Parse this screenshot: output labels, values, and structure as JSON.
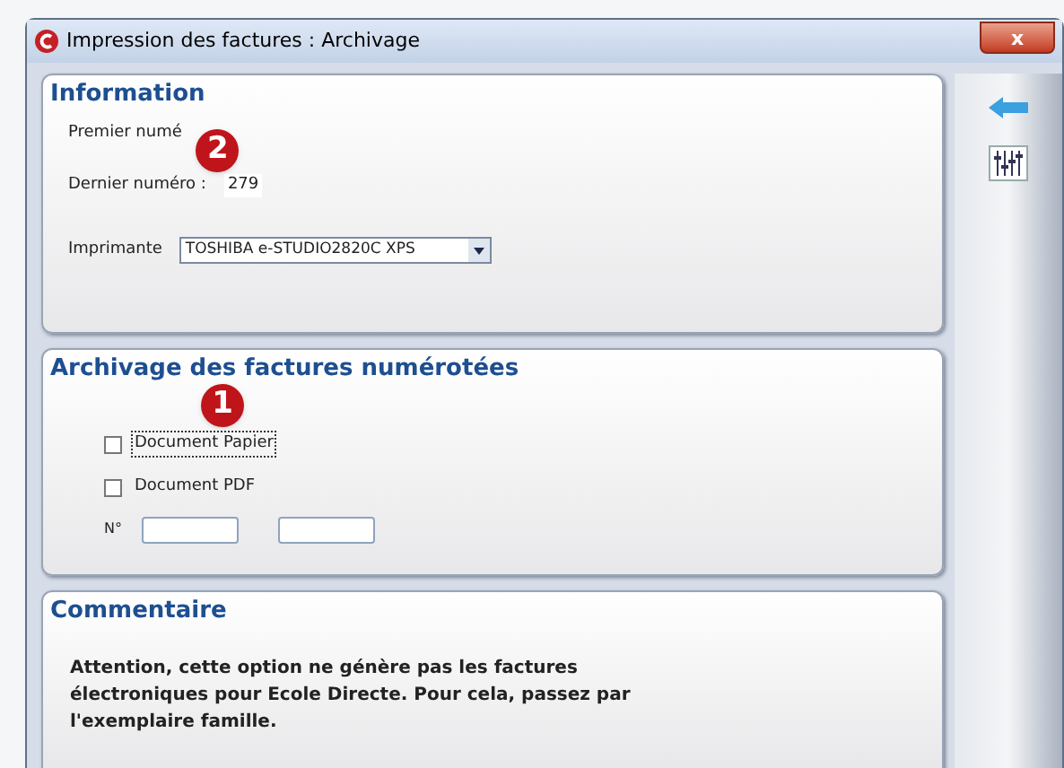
{
  "window": {
    "title": "Impression des factures : Archivage",
    "close": "x"
  },
  "information": {
    "title": "Information",
    "first_label": "Premier numé",
    "badge": "2",
    "last_label": "Dernier numéro :",
    "last_value": "279",
    "printer_label": "Imprimante",
    "printer_value": "TOSHIBA e-STUDIO2820C XPS"
  },
  "archivage": {
    "title": "Archivage des factures numérotées",
    "badge": "1",
    "options": [
      {
        "label": "Document Papier",
        "checked": false,
        "focused": true
      },
      {
        "label": "Document PDF",
        "checked": false,
        "focused": false
      }
    ],
    "number_label": "N°",
    "fields": [
      {
        "kind": "text"
      },
      {
        "kind": "text"
      }
    ]
  },
  "commentaire": {
    "title": "Commentaire",
    "text": "Attention, cette option ne génère pas les factures électroniques pour Ecole Directe. Pour cela, passez par l'exemplaire famille."
  }
}
